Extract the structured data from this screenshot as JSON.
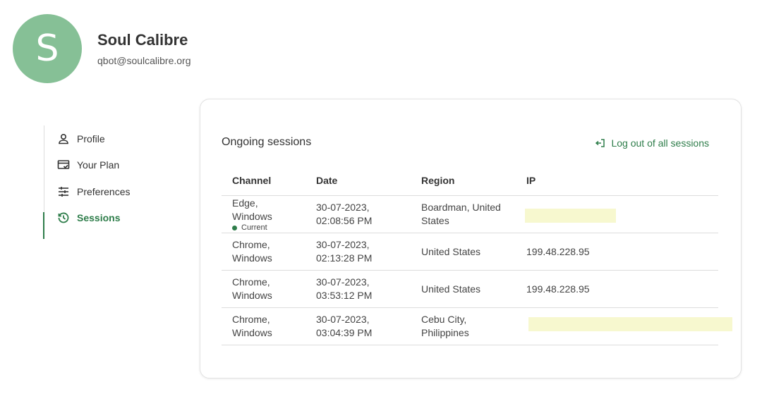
{
  "user": {
    "initial": "S",
    "name": "Soul Calibre",
    "email": "qbot@soulcalibre.org"
  },
  "sidebar": {
    "items": [
      {
        "label": "Profile",
        "icon": "person-icon"
      },
      {
        "label": "Your Plan",
        "icon": "card-check-icon"
      },
      {
        "label": "Preferences",
        "icon": "sliders-icon"
      },
      {
        "label": "Sessions",
        "icon": "history-icon",
        "active": true
      }
    ]
  },
  "sessions": {
    "title": "Ongoing sessions",
    "logout_all_label": "Log out of all sessions",
    "columns": [
      "Channel",
      "Date",
      "Region",
      "IP"
    ],
    "current_label": "Current",
    "rows": [
      {
        "channel_line1": "Edge,",
        "channel_line2": "Windows",
        "date_line1": "30-07-2023,",
        "date_line2": "02:08:56 PM",
        "region_line1": "Boardman, United",
        "region_line2": "States",
        "ip": ""
      },
      {
        "channel_line1": "Chrome,",
        "channel_line2": "Windows",
        "date_line1": "30-07-2023,",
        "date_line2": "02:13:28 PM",
        "region_line1": "United States",
        "region_line2": "",
        "ip": "199.48.228.95"
      },
      {
        "channel_line1": "Chrome,",
        "channel_line2": "Windows",
        "date_line1": "30-07-2023,",
        "date_line2": "03:53:12 PM",
        "region_line1": "United States",
        "region_line2": "",
        "ip": "199.48.228.95"
      },
      {
        "channel_line1": "Chrome,",
        "channel_line2": "Windows",
        "date_line1": "30-07-2023,",
        "date_line2": "03:04:39 PM",
        "region_line1": "Cebu City,",
        "region_line2": "Philippines",
        "ip": ""
      }
    ]
  },
  "colors": {
    "accent": "#2e7d4a",
    "avatar": "#86c096",
    "redaction": "#f7f8cf"
  }
}
